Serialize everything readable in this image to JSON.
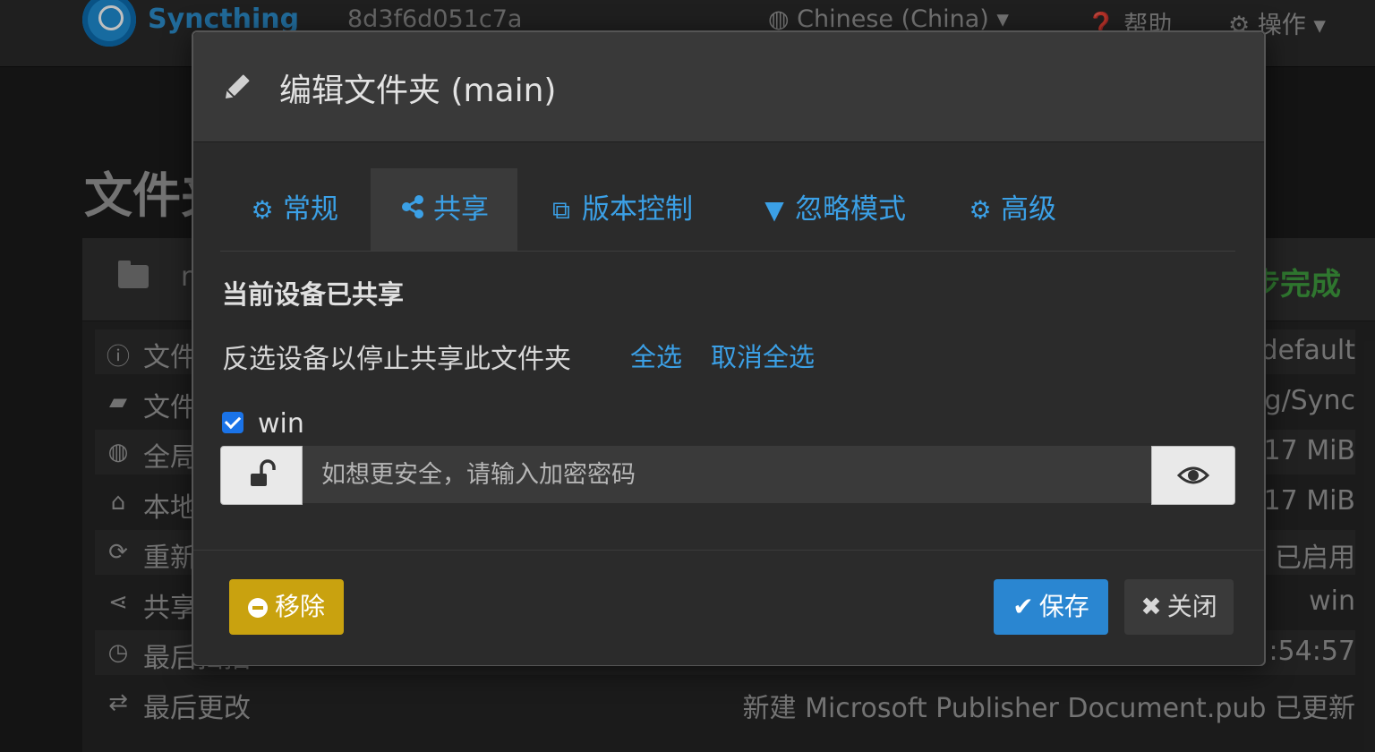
{
  "navbar": {
    "brand": "Syncthing",
    "device_id": "8d3f6d051c7a",
    "language": "Chinese (China)",
    "help": "帮助",
    "actions": "操作"
  },
  "background": {
    "heading_partial": "文件夹",
    "folder_name_partial": "m",
    "status_partial": "步完成",
    "rows": [
      {
        "icon": "info-icon",
        "label": "文件夹ID",
        "value": "default"
      },
      {
        "icon": "folder-open-icon",
        "label": "文件夹路径",
        "value": "g/Sync"
      },
      {
        "icon": "globe-icon",
        "label": "全局状态",
        "value": ".17 MiB"
      },
      {
        "icon": "home-icon",
        "label": "本地状态",
        "value": ".17 MiB"
      },
      {
        "icon": "refresh-icon",
        "label": "重新扫描",
        "value": "已启用"
      },
      {
        "icon": "share-icon",
        "label": "共享给",
        "value": "win"
      },
      {
        "icon": "clock-icon",
        "label": "最后扫描",
        "value": ":54:57"
      },
      {
        "icon": "exchange-icon",
        "label": "最后更改",
        "value": "新建 Microsoft Publisher Document.pub 已更新"
      }
    ]
  },
  "modal": {
    "title": "编辑文件夹 (main)",
    "tabs": [
      {
        "icon": "gear-icon",
        "label": "常规"
      },
      {
        "icon": "share-icon",
        "label": "共享"
      },
      {
        "icon": "copy-icon",
        "label": "版本控制"
      },
      {
        "icon": "filter-icon",
        "label": "忽略模式"
      },
      {
        "icon": "gears-icon",
        "label": "高级"
      }
    ],
    "section_title": "当前设备已共享",
    "hint": "反选设备以停止共享此文件夹",
    "select_all": "全选",
    "deselect_all": "取消全选",
    "device": {
      "name": "win",
      "checked": true
    },
    "password_placeholder": "如想更安全，请输入加密密码",
    "buttons": {
      "remove": "移除",
      "save": "保存",
      "close": "关闭"
    }
  },
  "colors": {
    "accent": "#3ba0e6",
    "warning": "#c9a20f",
    "primary": "#2a86d1",
    "success": "#3f9e3f"
  }
}
